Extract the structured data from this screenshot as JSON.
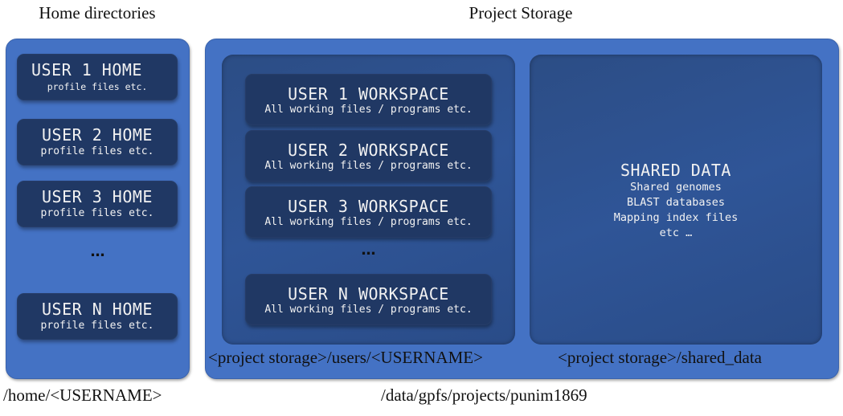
{
  "home": {
    "heading": "Home directories",
    "boxes": [
      {
        "title": "USER 1 HOME",
        "subtitle": "profile files etc."
      },
      {
        "title": "USER 2 HOME",
        "subtitle": "profile files etc."
      },
      {
        "title": "USER 3 HOME",
        "subtitle": "profile files etc."
      },
      {
        "title": "USER N HOME",
        "subtitle": "profile files etc."
      }
    ],
    "ellipsis": "…",
    "path": "/home/<USERNAME>"
  },
  "project": {
    "heading": "Project Storage",
    "workspaces": [
      {
        "title": "USER 1 WORKSPACE",
        "subtitle": "All working files / programs etc."
      },
      {
        "title": "USER 2 WORKSPACE",
        "subtitle": "All working files / programs etc."
      },
      {
        "title": "USER 3 WORKSPACE",
        "subtitle": "All working files / programs etc."
      },
      {
        "title": "USER N WORKSPACE",
        "subtitle": "All working files / programs etc."
      }
    ],
    "ellipsis": "…",
    "users_path": "<project storage>/users/<USERNAME>",
    "shared": {
      "title": "SHARED DATA",
      "lines": [
        "Shared genomes",
        "BLAST databases",
        "Mapping index files",
        "etc …"
      ]
    },
    "shared_path": "<project storage>/shared_data",
    "path": "/data/gpfs/projects/punim1869"
  },
  "colors": {
    "outer_panel": "#4472c4",
    "inner_area": "#2f5597",
    "box": "#203864",
    "box_text": "#f2f2f2"
  }
}
